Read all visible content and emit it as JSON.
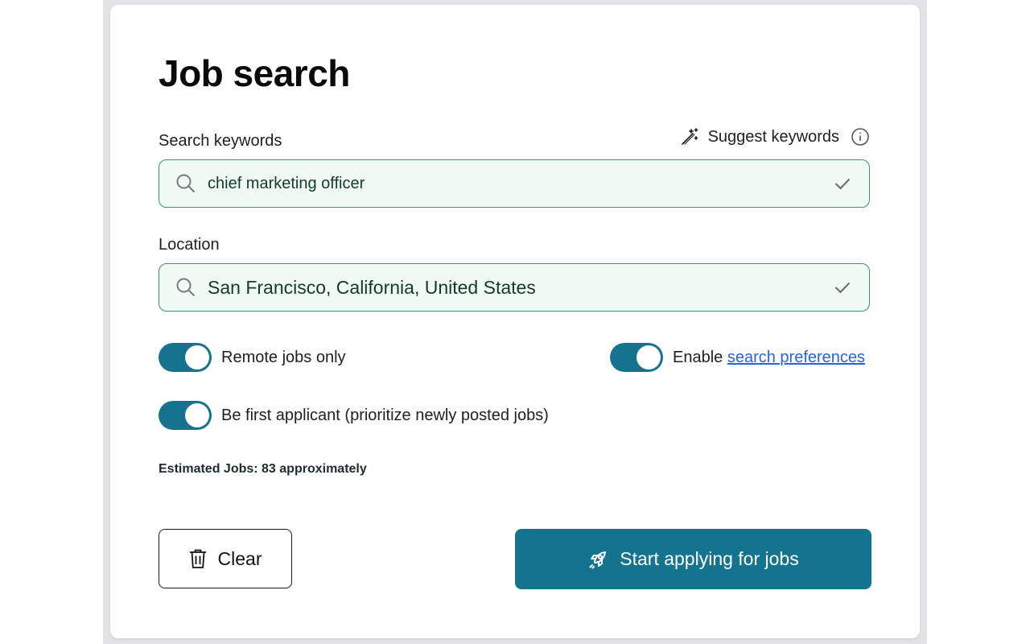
{
  "page": {
    "title": "Job search"
  },
  "keywords": {
    "label": "Search keywords",
    "value": "chief marketing officer",
    "suggest_label": "Suggest keywords",
    "icon": "search-icon",
    "status_icon": "check-icon"
  },
  "location": {
    "label": "Location",
    "value": "San Francisco, California, United States",
    "icon": "search-icon",
    "status_icon": "check-icon"
  },
  "toggles": {
    "remote": {
      "label": "Remote jobs only",
      "on": true
    },
    "preferences": {
      "label_prefix": "Enable ",
      "link_text": "search preferences",
      "on": true
    },
    "first_applicant": {
      "label": "Be first applicant (prioritize newly posted jobs)",
      "on": true
    }
  },
  "estimate": {
    "text": "Estimated Jobs: 83 approximately"
  },
  "actions": {
    "clear_label": "Clear",
    "start_label": "Start applying for jobs"
  },
  "colors": {
    "accent": "#14748f",
    "input_border": "#2e9a6a",
    "input_bg": "#f1faf5",
    "link": "#2563eb"
  }
}
